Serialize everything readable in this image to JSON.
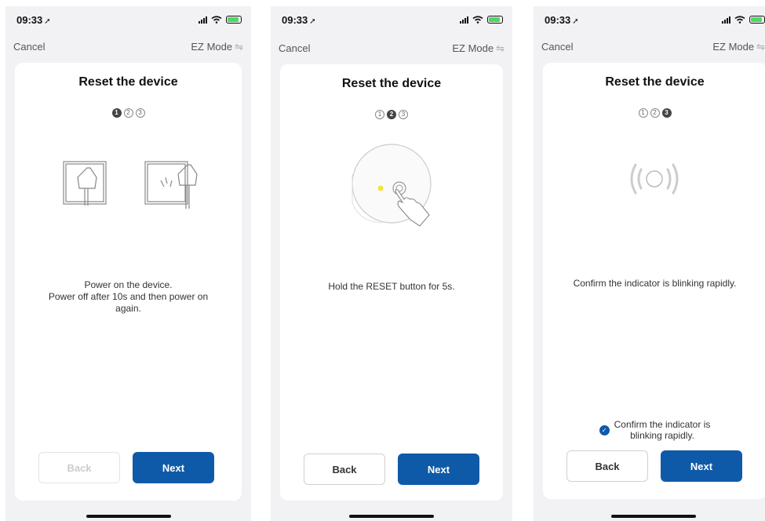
{
  "screens": [
    {
      "time": "09:33",
      "cancel": "Cancel",
      "mode": "EZ Mode",
      "title": "Reset the device",
      "steps": [
        "1",
        "2",
        "3"
      ],
      "active_step": 1,
      "illustration": "plug-socket-icon",
      "desc_lines": [
        "Power on the device.",
        "Power off after 10s and then power on",
        "again."
      ],
      "back": "Back",
      "back_enabled": false,
      "next": "Next"
    },
    {
      "time": "09:33",
      "cancel": "Cancel",
      "mode": "EZ Mode",
      "title": "Reset the device",
      "steps": [
        "1",
        "2",
        "3"
      ],
      "active_step": 2,
      "illustration": "press-reset-button-icon",
      "desc_lines": [
        "Hold the RESET button for 5s."
      ],
      "back": "Back",
      "back_enabled": true,
      "next": "Next"
    },
    {
      "time": "09:33",
      "cancel": "Cancel",
      "mode": "EZ Mode",
      "title": "Reset the device",
      "steps": [
        "1",
        "2",
        "3"
      ],
      "active_step": 3,
      "illustration": "blinking-indicator-icon",
      "desc_lines": [
        "Confirm the indicator is blinking rapidly."
      ],
      "confirm_lines": [
        "Confirm the indicator is",
        "blinking rapidly."
      ],
      "confirm_checked": true,
      "back": "Back",
      "back_enabled": true,
      "next": "Next"
    }
  ],
  "colors": {
    "primary": "#0f5aa8",
    "background": "#f2f2f4",
    "card": "#ffffff",
    "indicator": "#f5e33a"
  }
}
